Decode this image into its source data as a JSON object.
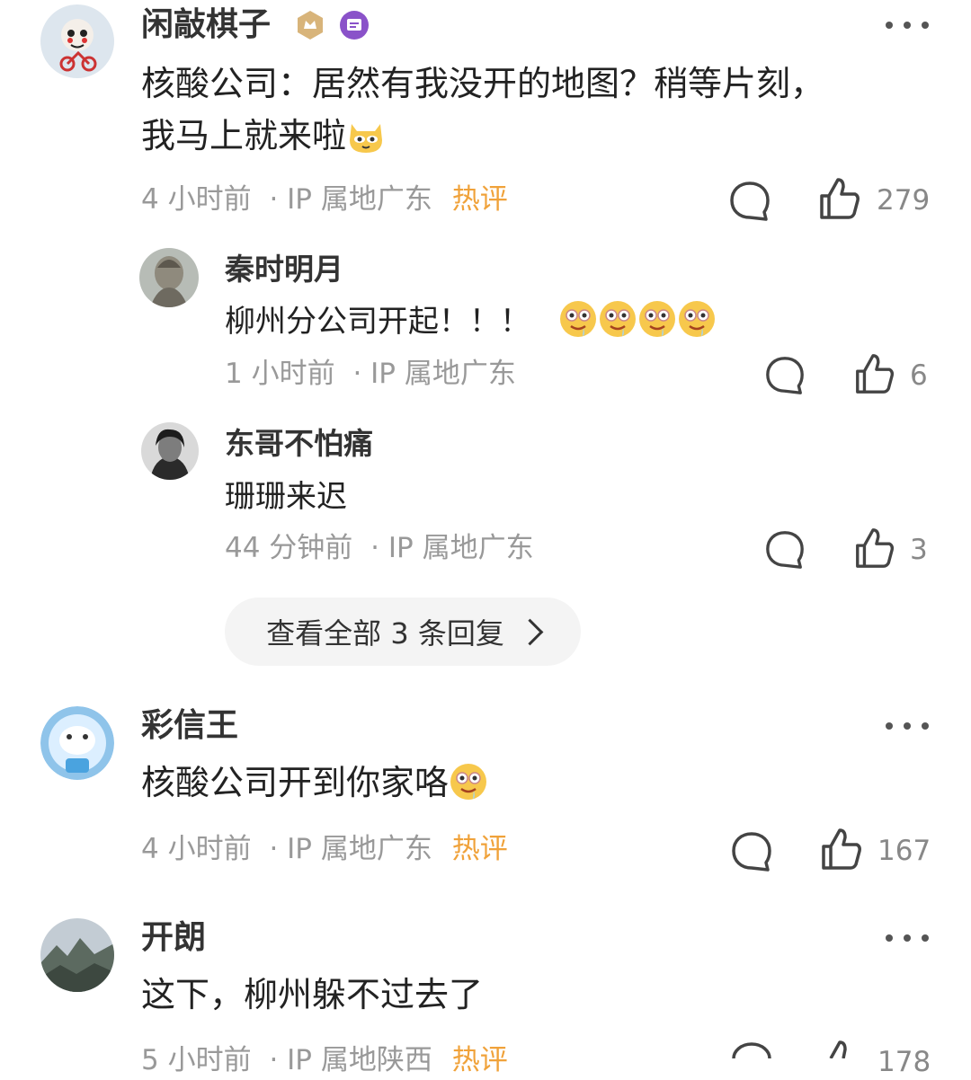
{
  "comments": [
    {
      "user": "闲敲棋子",
      "text_line1": "核酸公司：居然有我没开的地图？稍等片刻，",
      "text_line2": "我马上就来啦",
      "time": "4 小时前",
      "location": "· IP 属地广东",
      "hot": "热评",
      "likes": "279",
      "emoji": "cat-emoji"
    },
    {
      "user": "彩信王",
      "text": "核酸公司开到你家咯",
      "time": "4 小时前",
      "location": "· IP 属地广东",
      "hot": "热评",
      "likes": "167",
      "emoji": "drool-emoji"
    },
    {
      "user": "开朗",
      "text": "这下，柳州躲不过去了",
      "time": "5 小时前",
      "location": "· IP 属地陕西",
      "hot": "热评",
      "likes": "178"
    }
  ],
  "replies": [
    {
      "user": "秦时明月",
      "text": "柳州分公司开起！！！",
      "time": "1 小时前",
      "location": "· IP 属地广东",
      "likes": "6",
      "emoji": "drool-emoji"
    },
    {
      "user": "东哥不怕痛",
      "text": "珊珊来迟",
      "time": "44 分钟前",
      "location": "· IP 属地广东",
      "likes": "3"
    }
  ],
  "view_all_replies": "查看全部 3 条回复",
  "colors": {
    "hot": "#f0a23a",
    "meta": "#999999",
    "pill_bg": "#f4f4f4"
  }
}
